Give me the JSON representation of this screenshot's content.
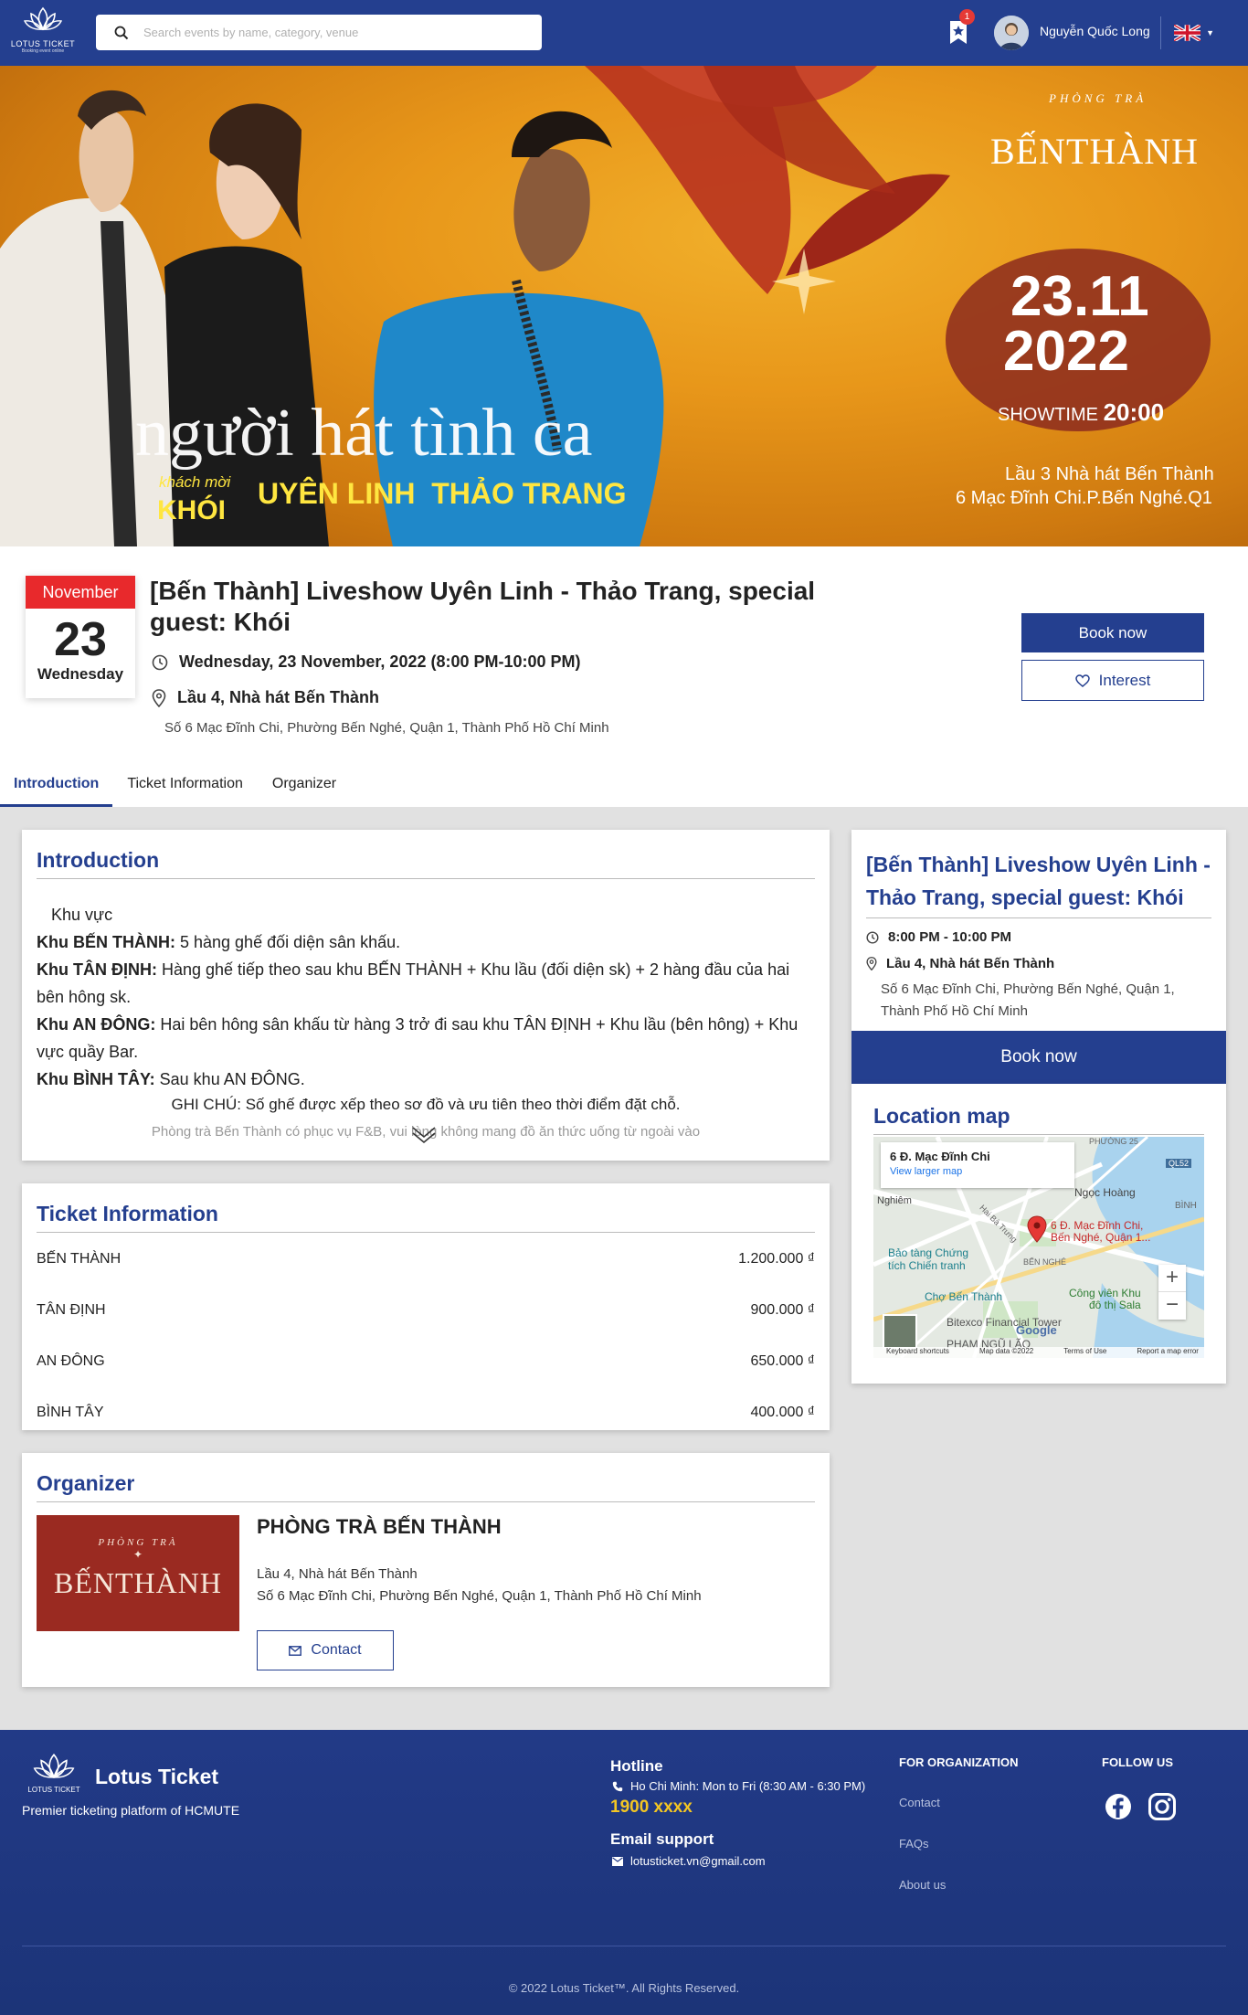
{
  "nav": {
    "logo_text": "LOTUS TICKET",
    "logo_sub": "Booking event online",
    "search_placeholder": "Search events by name, category, venue",
    "bookmark_count": "1",
    "username": "Nguyễn Quốc Long",
    "language": "en-GB"
  },
  "banner": {
    "brand_small": "PHÒNG TRÀ",
    "brand_big": "BẾNTHÀNH",
    "date_line1": "23.11",
    "date_line2": "2022",
    "showtime_label": "SHOWTIME",
    "showtime_value": "20:00",
    "venue_line1": "Lầu 3 Nhà hát Bến Thành",
    "venue_line2": "6 Mạc Đĩnh Chi.P.Bến Nghé.Q1",
    "show_name": "người hát tình ca",
    "guest_label": "khách mời",
    "guest_name": "KHÓI",
    "artists": "UYÊN LINH  THẢO TRANG"
  },
  "event": {
    "month": "November",
    "day": "23",
    "weekday": "Wednesday",
    "title": "[Bến Thành] Liveshow Uyên Linh - Thảo Trang, special guest: Khói",
    "datetime": "Wednesday, 23 November, 2022 (8:00 PM-10:00 PM)",
    "venue": "Lầu 4, Nhà hát Bến Thành",
    "address": "Số 6 Mạc Đĩnh Chi, Phường Bến Nghé, Quận 1, Thành Phố Hồ Chí Minh",
    "book_label": "Book now",
    "interest_label": "Interest"
  },
  "tabs": [
    {
      "label": "Introduction",
      "active": true
    },
    {
      "label": "Ticket Information",
      "active": false
    },
    {
      "label": "Organizer",
      "active": false
    }
  ],
  "introduction": {
    "heading": "Introduction",
    "lead": "Khu vực",
    "zones": [
      {
        "name": "Khu BẾN THÀNH:",
        "text": " 5 hàng ghế đối diện sân khấu."
      },
      {
        "name": "Khu TÂN ĐỊNH:",
        "text": " Hàng ghế tiếp theo sau khu BẾN THÀNH + Khu lầu (đối diện sk) + 2 hàng đầu của hai bên hông sk."
      },
      {
        "name": "Khu AN ĐÔNG:",
        "text": " Hai bên hông sân khấu từ hàng 3 trở đi sau khu TÂN ĐỊNH + Khu lầu (bên hông) + Khu vực quầy Bar."
      },
      {
        "name": "Khu BÌNH TÂY:",
        "text": " Sau khu AN ĐÔNG."
      }
    ],
    "note": "GHI CHÚ: Số ghế được xếp theo sơ đồ và ưu tiên theo thời điểm đặt chỗ.",
    "faded": "Phòng trà Bến Thành có phục vụ F&B, vui lòng không mang đồ ăn thức uống từ ngoài vào"
  },
  "tickets": {
    "heading": "Ticket Information",
    "rows": [
      {
        "name": "BẾN THÀNH",
        "price": "1.200.000 ₫"
      },
      {
        "name": "TÂN ĐỊNH",
        "price": "900.000 ₫"
      },
      {
        "name": "AN ĐÔNG",
        "price": "650.000 ₫"
      },
      {
        "name": "BÌNH TÂY",
        "price": "400.000 ₫"
      }
    ]
  },
  "organizer": {
    "heading": "Organizer",
    "logo_small": "PHÒNG TRÀ",
    "logo_big": "BẾNTHÀNH",
    "name": "PHÒNG TRÀ BẾN THÀNH",
    "address1": "Lầu 4, Nhà hát Bến Thành",
    "address2": "Số 6 Mạc Đĩnh Chi, Phường Bến Nghé, Quận 1, Thành Phố Hồ Chí Minh",
    "contact_label": "Contact"
  },
  "sidebar": {
    "title": "[Bến Thành] Liveshow Uyên Linh - Thảo Trang, special guest: Khói",
    "time": "8:00 PM - 10:00 PM",
    "venue": "Lầu 4, Nhà hát Bến Thành",
    "address": "Số 6 Mạc Đĩnh Chi, Phường Bến Nghé, Quận 1, Thành Phố Hồ Chí Minh",
    "book_label": "Book now"
  },
  "map": {
    "heading": "Location map",
    "place_name": "6 Đ. Mạc Đĩnh Chi",
    "larger_map": "View larger map",
    "pin_label1": "6 Đ. Mạc Đĩnh Chi,",
    "pin_label2": "Bến Nghé, Quận 1...",
    "labels": {
      "nghiem": "Nghiêm",
      "ngoc_hoang": "Ngọc Hoàng",
      "bao_tang1": "Bảo tàng Chứng",
      "bao_tang2": "tích Chiến tranh",
      "cho_ben_thanh": "Chợ Bến Thành",
      "cong_vien1": "Công viên Khu",
      "cong_vien2": "đô thị Sala",
      "bitexco": "Bitexco Financial Tower",
      "pham_ngu_lao": "PHẠM NGŨ LÃO",
      "ben_nghe": "BẾN NGHÉ",
      "hai_ba_trung": "Hai Bà Trưng",
      "binh": "BÌNH",
      "ql52": "QL52",
      "phuong": "PHƯỜNG 25"
    },
    "zoom_in": "+",
    "zoom_out": "−",
    "google": "Google",
    "attrib_shortcuts": "Keyboard shortcuts",
    "attrib_data": "Map data ©2022",
    "attrib_terms": "Terms of Use",
    "attrib_report": "Report a map error"
  },
  "footer": {
    "logo_text": "LOTUS TICKET",
    "brand": "Lotus Ticket",
    "tagline": "Premier ticketing platform of HCMUTE",
    "hotline_heading": "Hotline",
    "hotline_text": "Ho Chi Minh: Mon to Fri (8:30 AM - 6:30 PM)",
    "hotline_number": "1900 xxxx",
    "email_heading": "Email support",
    "email": "lotusticket.vn@gmail.com",
    "org_heading": "FOR ORGANIZATION",
    "org_links": [
      "Contact",
      "FAQs",
      "About us"
    ],
    "follow_heading": "FOLLOW US",
    "social": [
      "facebook-icon",
      "instagram-icon"
    ],
    "copyright": "© 2022 Lotus Ticket™. All Rights Reserved."
  },
  "colors": {
    "primary": "#243f8f",
    "accent_red": "#e8292c",
    "hotline_yellow": "#f3c623",
    "page_bg": "#e1e1e1"
  }
}
